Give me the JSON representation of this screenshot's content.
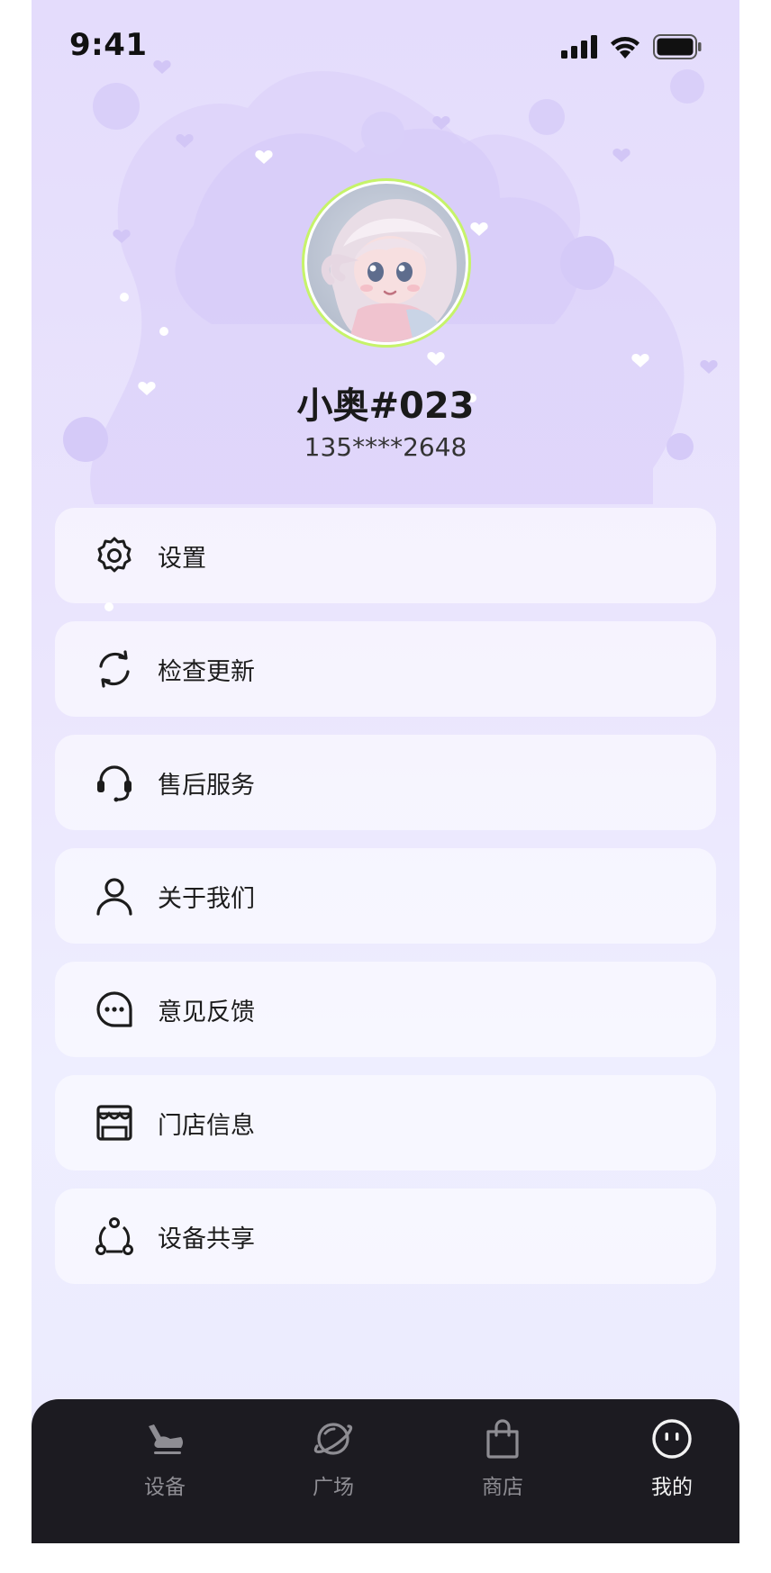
{
  "status_bar": {
    "time": "9:41",
    "icons": [
      "signal-icon",
      "wifi-icon",
      "battery-icon"
    ]
  },
  "profile": {
    "name": "小奥#023",
    "phone": "135****2648",
    "avatar": "avatar-image"
  },
  "menu": {
    "items": [
      {
        "label": "设置",
        "icon": "gear-icon"
      },
      {
        "label": "检查更新",
        "icon": "refresh-icon"
      },
      {
        "label": "售后服务",
        "icon": "headset-icon"
      },
      {
        "label": "关于我们",
        "icon": "person-icon"
      },
      {
        "label": "意见反馈",
        "icon": "chat-bubble-icon"
      },
      {
        "label": "门店信息",
        "icon": "store-icon"
      },
      {
        "label": "设备共享",
        "icon": "share-nodes-icon"
      }
    ]
  },
  "tabbar": {
    "tabs": [
      {
        "label": "设备",
        "icon": "device-icon",
        "active": false
      },
      {
        "label": "广场",
        "icon": "planet-icon",
        "active": false
      },
      {
        "label": "商店",
        "icon": "shopping-bag-icon",
        "active": false
      },
      {
        "label": "我的",
        "icon": "smiley-face-icon",
        "active": true
      }
    ]
  },
  "colors": {
    "background_top": "#e4dcfc",
    "background_bottom": "#ebeafd",
    "avatar_ring": "#c6f36a",
    "tabbar_bg": "#1c1b21",
    "tab_inactive": "#8e8d93",
    "tab_active": "#f2f2f2",
    "text_primary": "#1c1c1c"
  }
}
